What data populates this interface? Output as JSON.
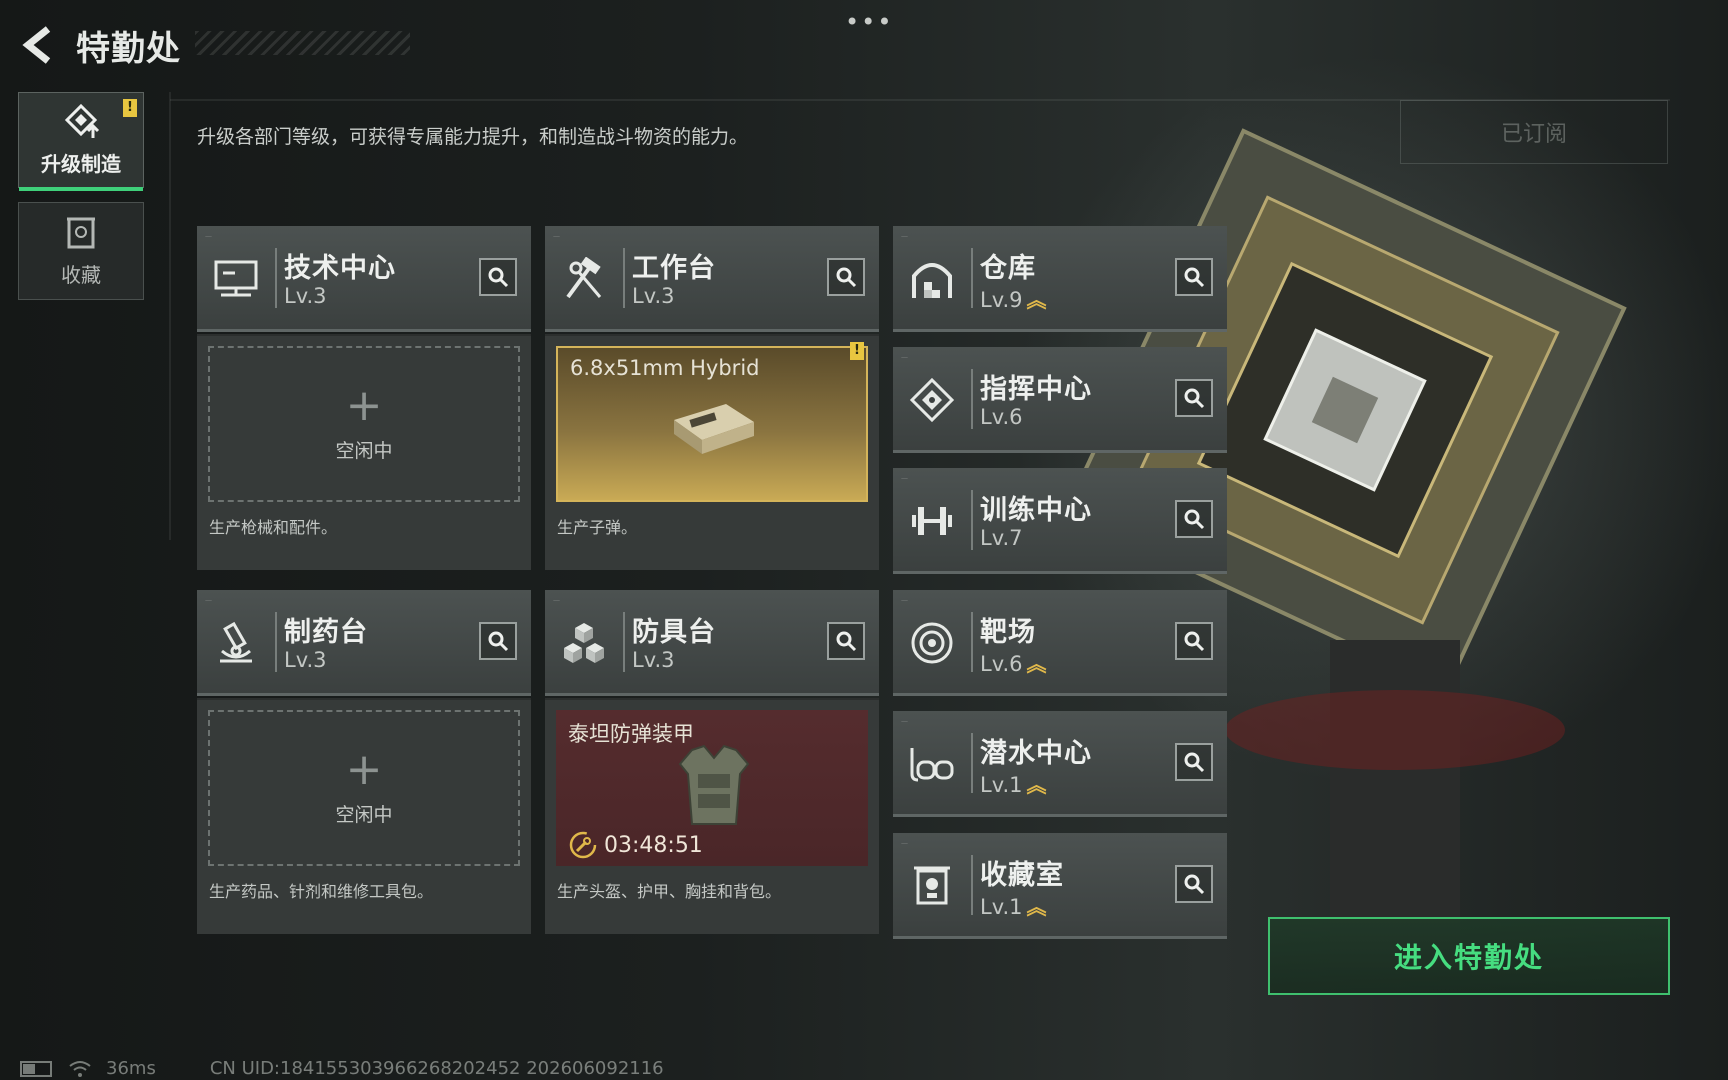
{
  "header": {
    "title": "特勤处",
    "more": "•••"
  },
  "nav": [
    {
      "label": "升级制造",
      "icon": "upgrade-icon",
      "active": true,
      "badge": "!"
    },
    {
      "label": "收藏",
      "icon": "collection-icon",
      "active": false
    }
  ],
  "description": "升级各部门等级，可获得专属能力提升，和制造战斗物资的能力。",
  "subscribed_label": "已订阅",
  "stations": [
    {
      "name": "技术中心",
      "level": "Lv.3",
      "icon": "monitor-icon",
      "upgrade": false
    },
    {
      "name": "工作台",
      "level": "Lv.3",
      "icon": "tools-icon",
      "upgrade": false
    },
    {
      "name": "仓库",
      "level": "Lv.9",
      "icon": "warehouse-icon",
      "upgrade": true
    },
    {
      "name": "指挥中心",
      "level": "Lv.6",
      "icon": "command-icon",
      "upgrade": false
    },
    {
      "name": "训练中心",
      "level": "Lv.7",
      "icon": "dumbbell-icon",
      "upgrade": false
    },
    {
      "name": "制药台",
      "level": "Lv.3",
      "icon": "microscope-icon",
      "upgrade": false
    },
    {
      "name": "防具台",
      "level": "Lv.3",
      "icon": "armor-blocks-icon",
      "upgrade": false
    },
    {
      "name": "靶场",
      "level": "Lv.6",
      "icon": "target-icon",
      "upgrade": true
    },
    {
      "name": "潜水中心",
      "level": "Lv.1",
      "icon": "diving-mask-icon",
      "upgrade": true
    },
    {
      "name": "收藏室",
      "level": "Lv.1",
      "icon": "display-case-icon",
      "upgrade": true
    }
  ],
  "production": [
    {
      "state": "idle",
      "plus": "+",
      "status": "空闲中",
      "description": "生产枪械和配件。"
    },
    {
      "state": "ready",
      "item": "6.8x51mm Hybrid",
      "badge": "!",
      "description": "生产子弹。"
    },
    {
      "state": "idle",
      "plus": "+",
      "status": "空闲中",
      "description": "生产药品、针剂和维修工具包。"
    },
    {
      "state": "crafting",
      "item": "泰坦防弹装甲",
      "timer": "03:48:51",
      "description": "生产头盔、护甲、胸挂和背包。"
    }
  ],
  "enter_button": "进入特勤处",
  "status_bar": {
    "ping": "36ms",
    "uid": "CN UID:184155303966268202452 202606092116"
  },
  "colors": {
    "accent_green": "#46dd80",
    "upgrade_gold": "#e0b84a",
    "badge_yellow": "#e8c640"
  }
}
